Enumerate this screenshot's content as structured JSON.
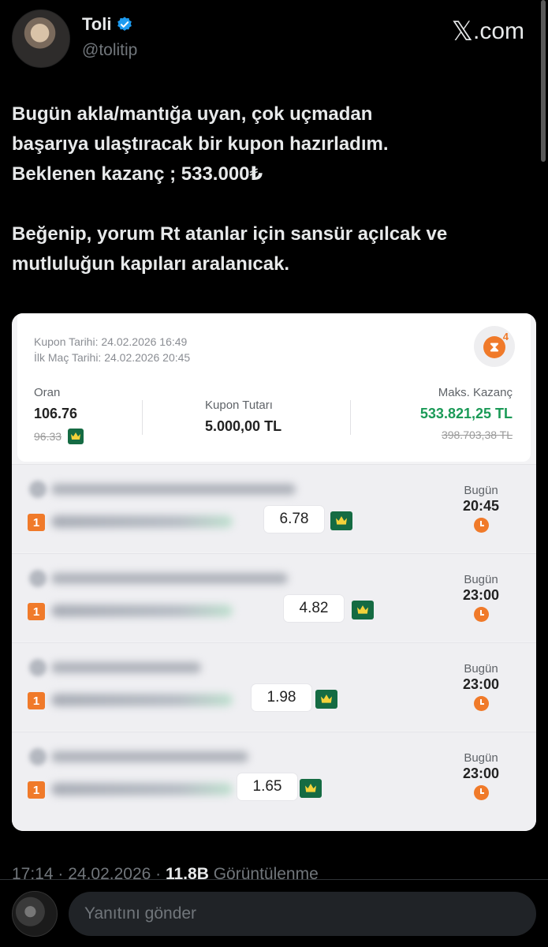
{
  "author": {
    "name": "Toli",
    "handle": "@tolitip",
    "verified": true
  },
  "brand": {
    "x_glyph": "𝕏",
    "text": ".com"
  },
  "tweet": {
    "paragraph1": "Bugün akla/mantığa uyan, çok uçmadan\nbaşarıya ulaştıracak bir kupon hazırladım.\nBeklenen kazanç ; 533.000₺",
    "paragraph2": "Beğenip, yorum Rt atanlar için sansür açılcak ve\nmutluluğun kapıları aralanıcak."
  },
  "coupon": {
    "date_line": "Kupon Tarihi: 24.02.2026 16:49",
    "first_match_line": "İlk Maç Tarihi: 24.02.2026 20:45",
    "badge_count": "4",
    "oran_label": "Oran",
    "oran_value": "106.76",
    "oran_old": "96.33",
    "tutar_label": "Kupon Tutarı",
    "tutar_value": "5.000,00 TL",
    "kazanc_label": "Maks. Kazanç",
    "kazanc_value": "533.821,25 TL",
    "kazanc_old": "398.703,38 TL"
  },
  "matches": [
    {
      "num": "1",
      "odd": "6.78",
      "day": "Bugün",
      "time": "20:45"
    },
    {
      "num": "1",
      "odd": "4.82",
      "day": "Bugün",
      "time": "23:00"
    },
    {
      "num": "1",
      "odd": "1.98",
      "day": "Bugün",
      "time": "23:00"
    },
    {
      "num": "1",
      "odd": "1.65",
      "day": "Bugün",
      "time": "23:00"
    }
  ],
  "footer": {
    "time": "17:14 · 24.02.2026 · ",
    "views_count": "11,8B",
    "views_label": " Görüntülenme",
    "reply_placeholder": "Yanıtını gönder"
  },
  "colors": {
    "accent_orange": "#f07a2a",
    "win_green": "#1b9a57",
    "crown_green": "#156b43",
    "verified_blue": "#1d9bf0"
  }
}
